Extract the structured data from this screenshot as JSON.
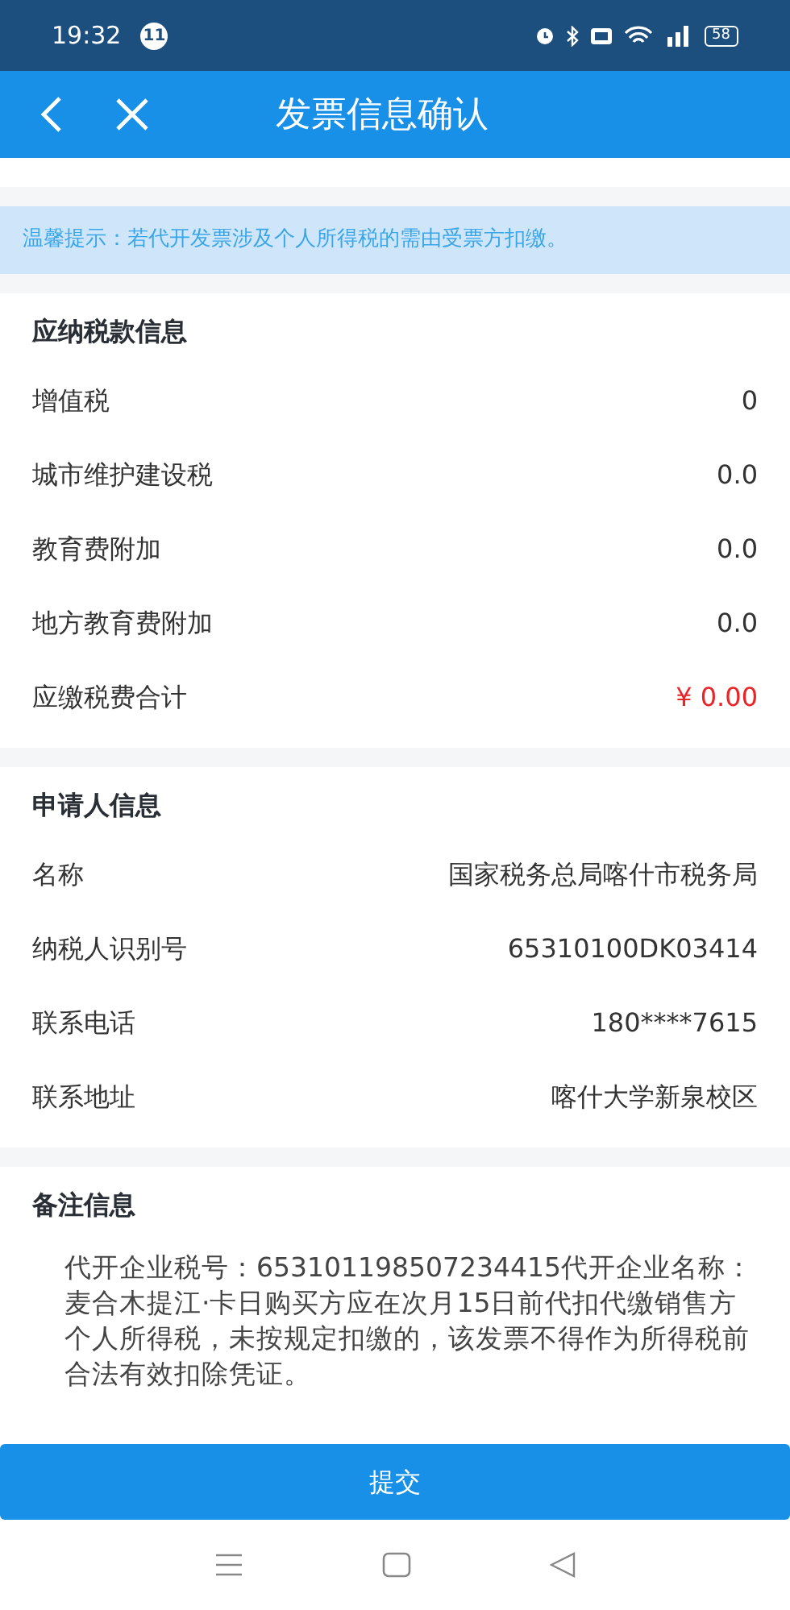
{
  "status_bar": {
    "time": "19:32",
    "notification_count": "11",
    "battery": "58"
  },
  "header": {
    "title": "发票信息确认"
  },
  "notice": "温馨提示：若代开发票涉及个人所得税的需由受票方扣缴。",
  "tax_section": {
    "title": "应纳税款信息",
    "rows": [
      {
        "label": "增值税",
        "value": "0",
        "kind": "normal"
      },
      {
        "label": "城市维护建设税",
        "value": "0.0",
        "kind": "normal"
      },
      {
        "label": "教育费附加",
        "value": "0.0",
        "kind": "normal"
      },
      {
        "label": "地方教育费附加",
        "value": "0.0",
        "kind": "normal"
      },
      {
        "label": "应缴税费合计",
        "value": "¥ 0.00",
        "kind": "total"
      }
    ]
  },
  "applicant_section": {
    "title": "申请人信息",
    "rows": [
      {
        "label": "名称",
        "value": "国家税务总局喀什市税务局"
      },
      {
        "label": "纳税人识别号",
        "value": "65310100DK03414"
      },
      {
        "label": "联系电话",
        "value": "180****7615"
      },
      {
        "label": "联系地址",
        "value": "喀什大学新泉校区"
      }
    ]
  },
  "remarks_section": {
    "title": "备注信息",
    "text": "代开企业税号：653101198507234415代开企业名称：麦合木提江·卡日购买方应在次月15日前代扣代缴销售方个人所得税，未按规定扣缴的，该发票不得作为所得税前合法有效扣除凭证。"
  },
  "submit_button": "提交"
}
